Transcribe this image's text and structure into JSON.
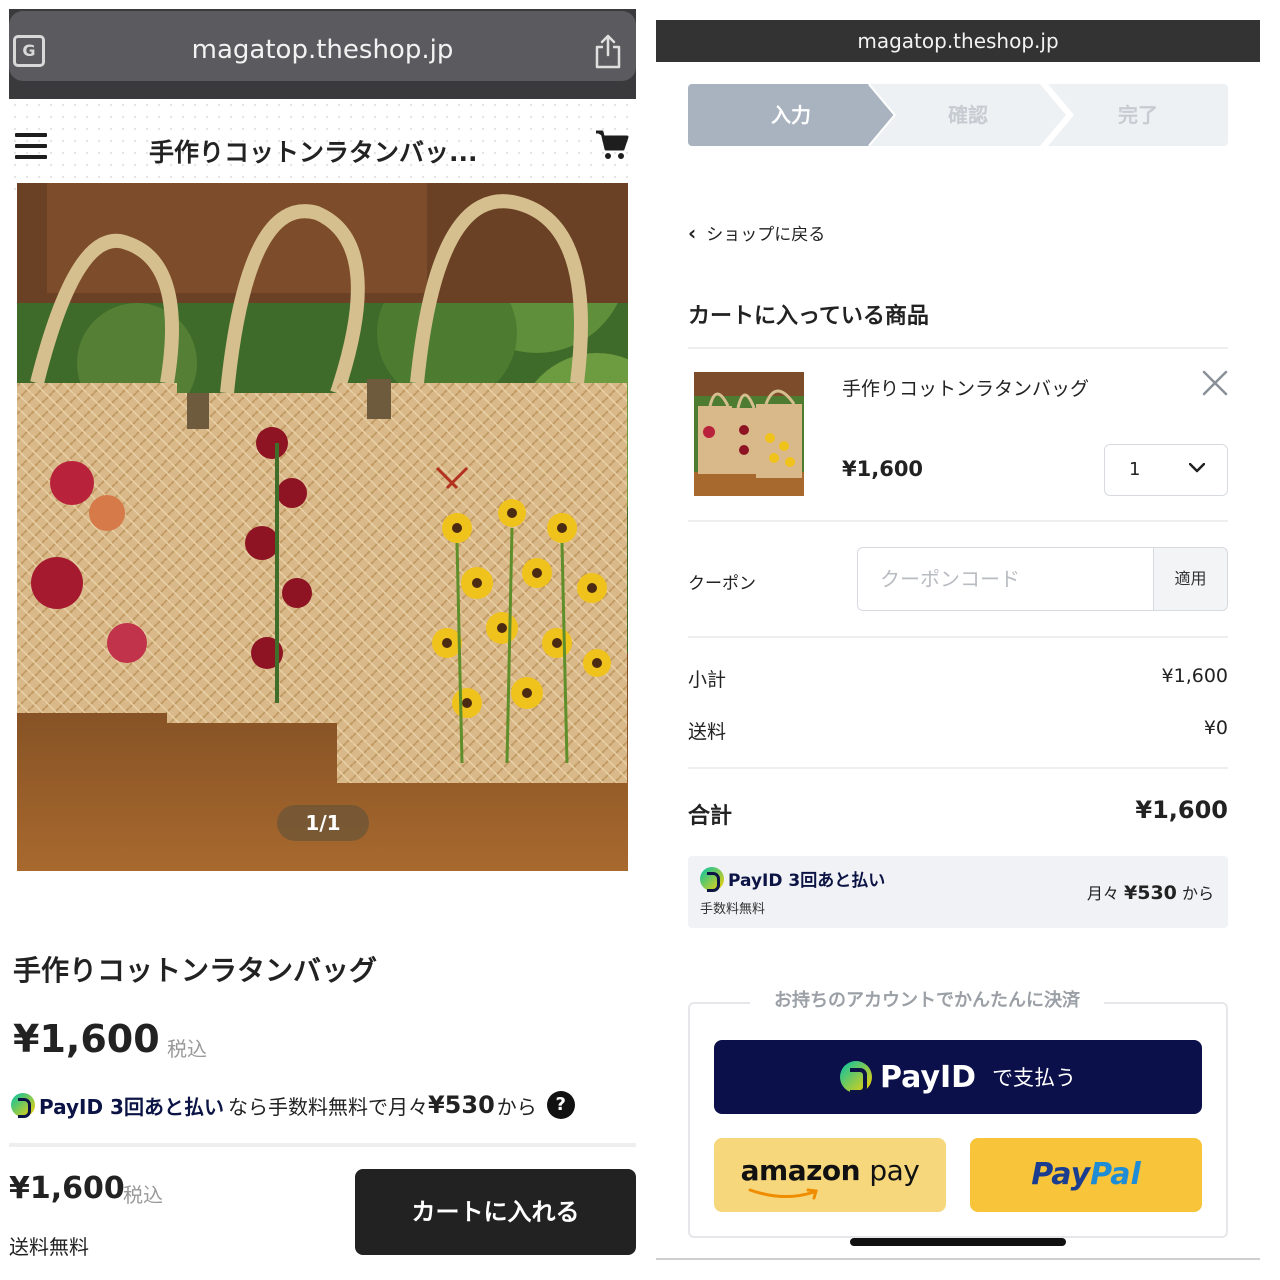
{
  "left": {
    "browser": {
      "url": "magatop.theshop.jp",
      "translate_icon": "translate-icon",
      "share_icon": "share-icon"
    },
    "header": {
      "title": "手作りコットンラタンバッ...",
      "menu_icon": "hamburger-menu-icon",
      "cart_icon": "cart-icon"
    },
    "gallery": {
      "counter": "1/1"
    },
    "product": {
      "name": "手作りコットンラタンバッグ",
      "price": "¥1,600",
      "tax_label": "税込",
      "payid": {
        "brand": "PayID 3回あと払い",
        "text": "なら手数料無料で月々",
        "amount": "¥530",
        "suffix": "から",
        "help": "?"
      }
    },
    "footer": {
      "price": "¥1,600",
      "tax_label": "税込",
      "shipping": "送料無料",
      "add_to_cart": "カートに入れる"
    }
  },
  "right": {
    "browser": {
      "url": "magatop.theshop.jp"
    },
    "steps": [
      "入力",
      "確認",
      "完了"
    ],
    "back_link": "ショップに戻る",
    "section_title": "カートに入っている商品",
    "item": {
      "name": "手作りコットンラタンバッグ",
      "price": "¥1,600",
      "quantity": "1"
    },
    "coupon": {
      "label": "クーポン",
      "placeholder": "クーポンコード",
      "apply": "適用"
    },
    "subtotal": {
      "label": "小計",
      "value": "¥1,600"
    },
    "shipping": {
      "label": "送料",
      "value": "¥0"
    },
    "total": {
      "label": "合計",
      "value": "¥1,600"
    },
    "payid_box": {
      "brand": "PayID 3回あと払い",
      "fee": "手数料無料",
      "monthly_prefix": "月々",
      "monthly_amount": "¥530",
      "monthly_suffix": "から"
    },
    "account_payment": {
      "title": "お持ちのアカウントでかんたんに決済",
      "payid_brand": "PayID",
      "payid_text": "で支払う",
      "amazon_word": "amazon",
      "amazon_pay": "pay",
      "paypal_1": "Pay",
      "paypal_2": "Pal"
    }
  }
}
